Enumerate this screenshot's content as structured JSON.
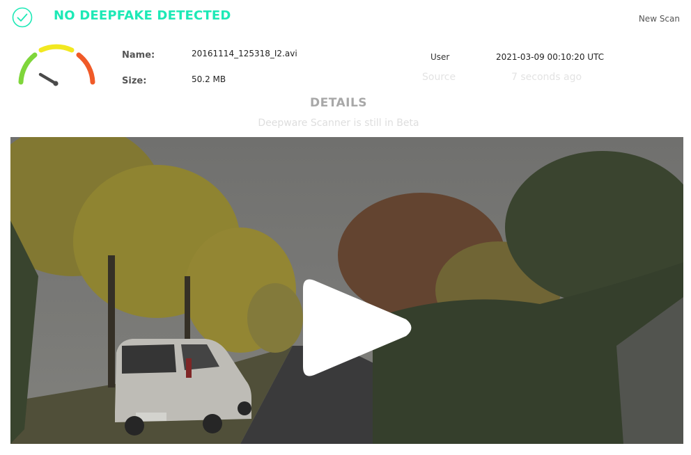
{
  "header": {
    "status_title": "NO DEEPFAKE DETECTED",
    "new_scan_label": "New Scan",
    "status_color": "#1de9b6"
  },
  "gauge": {
    "colors": [
      "#7fd63b",
      "#f2e820",
      "#f05a28"
    ]
  },
  "file": {
    "name_label": "Name:",
    "name_value": "20161114_125318_I2.avi",
    "size_label": "Size:",
    "size_value": "50.2 MB"
  },
  "meta": {
    "user_label": "User",
    "user_value": "2021-03-09 00:10:20 UTC",
    "source_label": "Source",
    "source_value": "7 seconds ago"
  },
  "details": {
    "title": "DETAILS",
    "subtitle": "Deepware Scanner is still in Beta"
  },
  "video": {
    "play_icon": "play-icon"
  }
}
